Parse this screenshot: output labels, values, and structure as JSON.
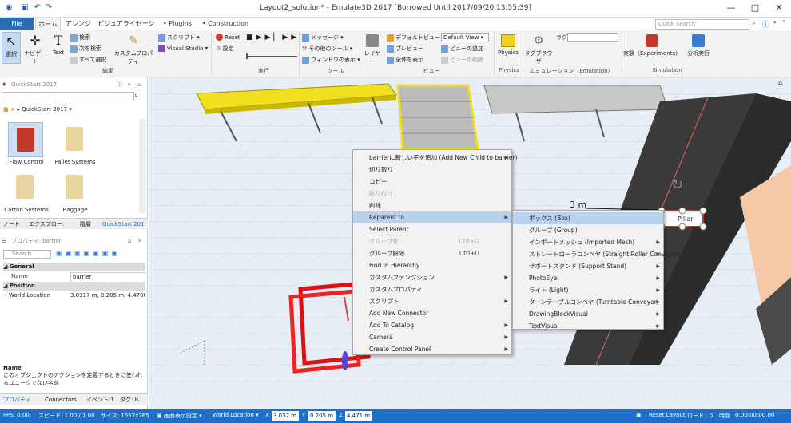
{
  "window": {
    "title": "Layout2_solution* - Emulate3D 2017 [Borrowed Until 2017/09/20 13:55:39]"
  },
  "tabs": {
    "file": "File",
    "home": "ホーム",
    "arrange": "アレンジ",
    "visualization": "ビジュアライゼーション",
    "plugins": "Plugins",
    "construction": "Construction",
    "search_placeholder": "Quick Search"
  },
  "ribbon": {
    "edit": {
      "select": "選択",
      "navigate": "ナビゲート",
      "text": "Text",
      "search": "検索",
      "find_next": "次を検索",
      "select_all": "すべて選択",
      "custom_props": "カスタムプロパティ",
      "script": "スクリプト",
      "visual_studio": "Visual Studio",
      "label": "編集"
    },
    "run": {
      "reset": "Reset",
      "settings": "設定",
      "label": "実行"
    },
    "tools": {
      "message": "メッセージ",
      "other_tools": "その他のツール",
      "window_show": "ウィンドウの表示",
      "label": "ツール"
    },
    "view": {
      "layer": "レイヤー",
      "default_view": "デフォルトビュー",
      "preview": "プレビュー",
      "show_all": "全体を表示",
      "default_view_select": "Default View",
      "add_view": "ビューの追加",
      "delete_view": "ビューの削除",
      "label": "ビュー"
    },
    "physics": {
      "button": "Physics",
      "label": "Physics"
    },
    "emulation": {
      "tag_browser": "タグブラウザ",
      "tag": "ラグ",
      "label": "エミュレーション（Emulation）"
    },
    "simulation": {
      "experiments": "実験（Experiments）",
      "analysis": "分析実行",
      "label": "Simulation"
    }
  },
  "quickstart": {
    "title": "QuickStart 2017",
    "breadcrumb": "QuickStart 2017",
    "items": [
      {
        "label": "Flow Control"
      },
      {
        "label": "Pallet Systems"
      },
      {
        "label": "Carton Systems"
      },
      {
        "label": "Baggage"
      }
    ],
    "tabs": [
      "ノート",
      "エクスプロー:",
      "階層",
      "QuickStart 201"
    ]
  },
  "properties": {
    "title": "プロパティ: barrier",
    "search_placeholder": "Search",
    "general": "General",
    "name_key": "Name",
    "name_val": "barrier",
    "position": "Position",
    "world_location_key": "World Location",
    "world_location_val": "3.0317 m, 0.205 m, 4.4706",
    "desc_title": "Name",
    "desc_text": "このオブジェクトのアクションを定義するときに使われるユニークでない名前",
    "tabs": [
      "プロパティ",
      "Connectors",
      "イベント:1",
      "タグ: b"
    ]
  },
  "context_menu": {
    "items": [
      {
        "label": "barrierに新しい子を追加 (Add New Child to barrier)",
        "arrow": true
      },
      {
        "label": "切り取り"
      },
      {
        "label": "コピー"
      },
      {
        "label": "貼り付け",
        "disabled": true
      },
      {
        "label": "削除"
      },
      {
        "label": "Reparent to",
        "arrow": true,
        "highlight": true
      },
      {
        "label": "Select Parent"
      },
      {
        "label": "グループ化",
        "shortcut": "Ctrl+G",
        "disabled": true
      },
      {
        "label": "グループ解除",
        "shortcut": "Ctrl+U"
      },
      {
        "label": "Find In Hierarchy"
      },
      {
        "label": "カスタムファンクション",
        "arrow": true
      },
      {
        "label": "カスタムプロパティ"
      },
      {
        "label": "スクリプト",
        "arrow": true
      },
      {
        "label": "Add New Connector"
      },
      {
        "label": "Add To Catalog",
        "arrow": true
      },
      {
        "label": "Camera",
        "arrow": true
      },
      {
        "label": "Create Control Panel",
        "arrow": true
      }
    ]
  },
  "submenu": {
    "items": [
      {
        "label": "ボックス (Box)",
        "highlight": true
      },
      {
        "label": "グループ (Group)"
      },
      {
        "label": "インポートメッシュ (Imported Mesh)",
        "arrow": true
      },
      {
        "label": "ストレートローラコンベヤ (Straight Roller Conveyor)",
        "arrow": true
      },
      {
        "label": "サポートスタンド (Support Stand)",
        "arrow": true
      },
      {
        "label": "PhotoEye",
        "arrow": true
      },
      {
        "label": "ライト (Light)",
        "arrow": true
      },
      {
        "label": "ターンテーブルコンベヤ (Turntable Conveyor)",
        "arrow": true
      },
      {
        "label": "DrawingBlockVisual",
        "arrow": true
      },
      {
        "label": "TextVisual",
        "arrow": true
      }
    ]
  },
  "viewport": {
    "measure": "3 m",
    "pillar": "Pillar"
  },
  "status": {
    "fps": "FPS: 0.00",
    "speed": "スピード: 1.00 / 1.00",
    "size": "サイズ: 1552x765",
    "display": "画面表示設定",
    "world_location": "World Location",
    "x_label": "X",
    "x": "3.032 m",
    "y_label": "Y",
    "y": "0.205 m",
    "z_label": "Z",
    "z": "4.471 m",
    "reset_layout": "Reset Layout",
    "load": "ロード : 0",
    "time_label": "時間 :",
    "time": "0:00:00:00.00"
  }
}
